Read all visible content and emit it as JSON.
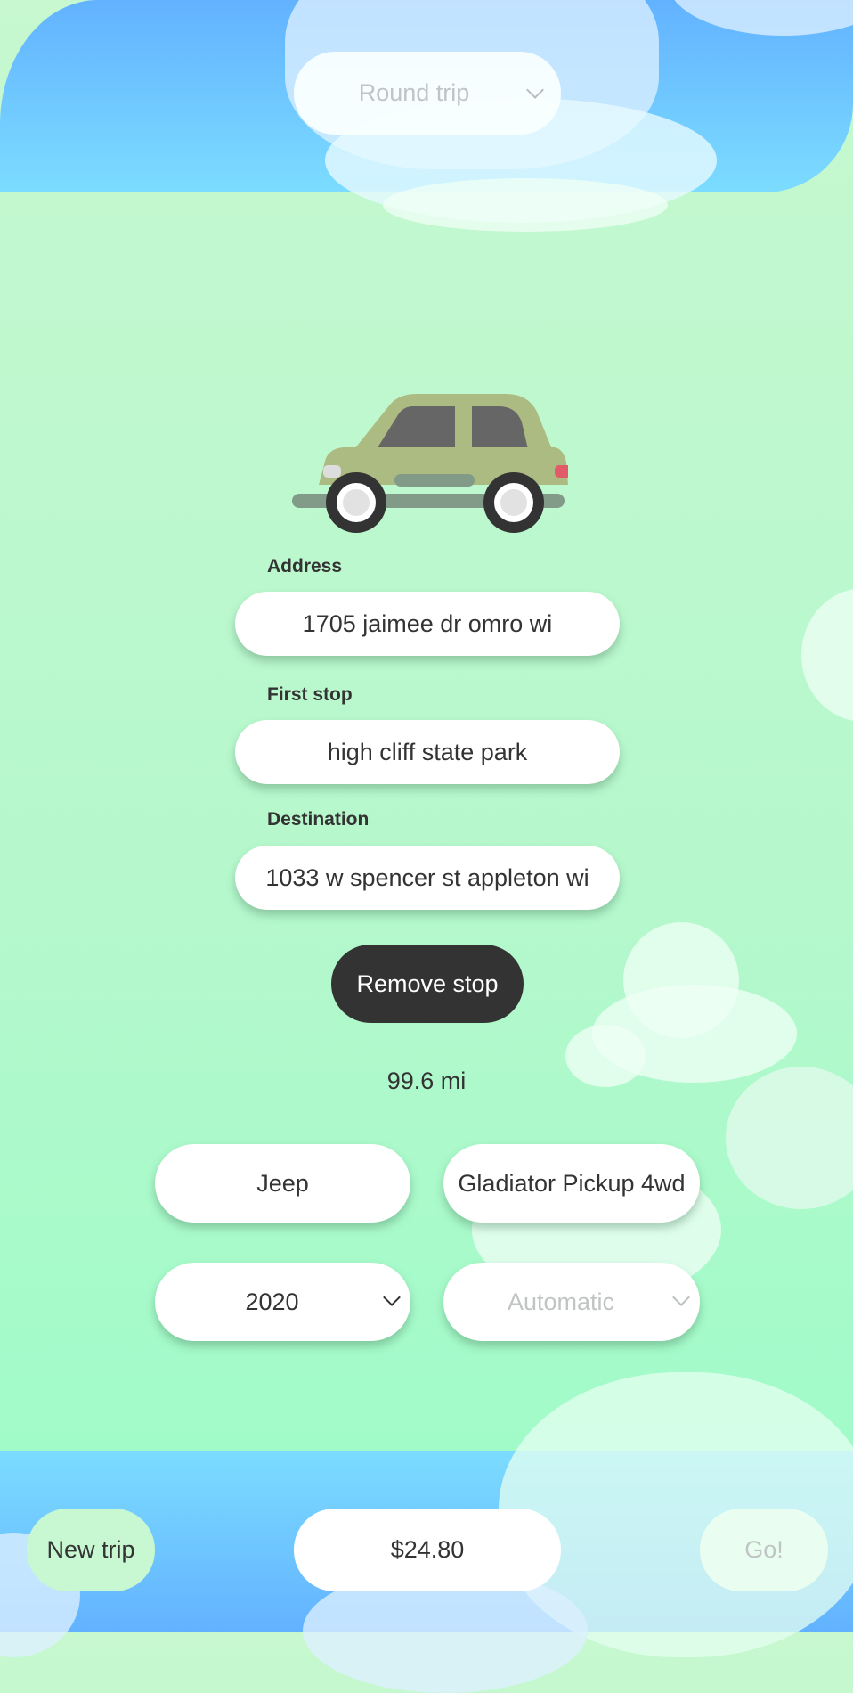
{
  "header": {
    "trip_type_select": {
      "value": "Round trip",
      "icon": "chevron-down-icon"
    }
  },
  "illustration": {
    "icon": "car-icon"
  },
  "form": {
    "address": {
      "label": "Address",
      "value": "1705 jaimee dr omro wi"
    },
    "first_stop": {
      "label": "First stop",
      "value": "high cliff state park"
    },
    "destination": {
      "label": "Destination",
      "value": "1033 w spencer st appleton wi"
    },
    "remove_stop_label": "Remove stop",
    "distance": "99.6 mi"
  },
  "vehicle": {
    "make": "Jeep",
    "model": "Gladiator Pickup 4wd",
    "year": {
      "value": "2020",
      "icon": "chevron-down-icon"
    },
    "transmission": {
      "value": "Automatic",
      "icon": "chevron-down-icon"
    }
  },
  "footer": {
    "new_trip_label": "New trip",
    "price": "$24.80",
    "go_label": "Go!"
  },
  "colors": {
    "sky_top": "#62b2ff",
    "sky_bottom": "#7cdcff",
    "grass_top": "#c7f8d0",
    "grass_bottom": "#9afcc8",
    "dark_button": "#333333",
    "car_body": "#abbb82",
    "car_window": "#666666",
    "tail_light": "#e25b68"
  }
}
